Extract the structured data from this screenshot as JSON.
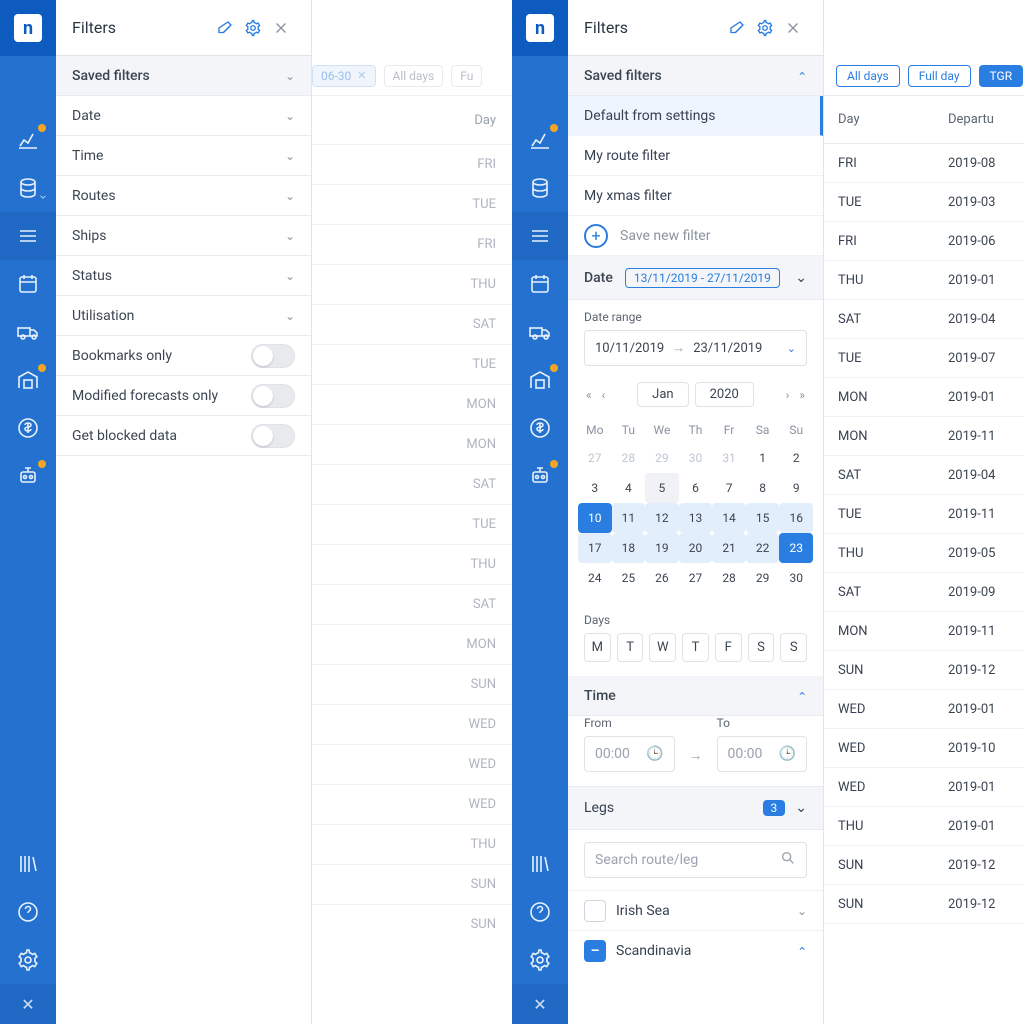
{
  "left": {
    "panelTitle": "Filters",
    "sections": [
      "Saved filters",
      "Date",
      "Time",
      "Routes",
      "Ships",
      "Status",
      "Utilisation"
    ],
    "toggles": [
      "Bookmarks only",
      "Modified forecasts only",
      "Get blocked data"
    ],
    "fadedChipActive": "06-30",
    "fadedChips": [
      "All days",
      "Fu"
    ],
    "dayHeader": "Day",
    "dayRows": [
      "FRI",
      "TUE",
      "FRI",
      "THU",
      "SAT",
      "TUE",
      "MON",
      "MON",
      "SAT",
      "TUE",
      "THU",
      "SAT",
      "MON",
      "SUN",
      "WED",
      "WED",
      "WED",
      "THU",
      "SUN",
      "SUN"
    ],
    "arrowRows": [
      0,
      7,
      14
    ]
  },
  "right": {
    "panelTitle": "Filters",
    "savedHeader": "Saved filters",
    "savedItems": [
      "Default from settings",
      "My route filter",
      "My xmas filter"
    ],
    "saveNew": "Save new filter",
    "dateLabel": "Date",
    "dateChip": "13/11/2019 - 27/11/2019",
    "dateRangeLabel": "Date range",
    "rangeFrom": "10/11/2019",
    "rangeTo": "23/11/2019",
    "monthLabel": "Jan",
    "yearLabel": "2020",
    "weekDays": [
      "Mo",
      "Tu",
      "We",
      "Th",
      "Fr",
      "Sa",
      "Su"
    ],
    "calCells": [
      {
        "n": "27",
        "m": true
      },
      {
        "n": "28",
        "m": true
      },
      {
        "n": "29",
        "m": true
      },
      {
        "n": "30",
        "m": true
      },
      {
        "n": "31",
        "m": true
      },
      {
        "n": "1"
      },
      {
        "n": "2"
      },
      {
        "n": "3"
      },
      {
        "n": "4"
      },
      {
        "n": "5",
        "today": true
      },
      {
        "n": "6"
      },
      {
        "n": "7"
      },
      {
        "n": "8"
      },
      {
        "n": "9"
      },
      {
        "n": "10",
        "start": true
      },
      {
        "n": "11",
        "in": true
      },
      {
        "n": "12",
        "in": true
      },
      {
        "n": "13",
        "in": true
      },
      {
        "n": "14",
        "in": true
      },
      {
        "n": "15",
        "in": true
      },
      {
        "n": "16",
        "in": true
      },
      {
        "n": "17",
        "in": true
      },
      {
        "n": "18",
        "in": true
      },
      {
        "n": "19",
        "in": true
      },
      {
        "n": "20",
        "in": true
      },
      {
        "n": "21",
        "in": true
      },
      {
        "n": "22",
        "in": true
      },
      {
        "n": "23",
        "end": true
      },
      {
        "n": "24"
      },
      {
        "n": "25"
      },
      {
        "n": "26"
      },
      {
        "n": "27"
      },
      {
        "n": "28"
      },
      {
        "n": "29"
      },
      {
        "n": "30"
      }
    ],
    "daysLabel": "Days",
    "dayBtns": [
      "M",
      "T",
      "W",
      "T",
      "F",
      "S",
      "S"
    ],
    "timeLabel": "Time",
    "fromLabel": "From",
    "toLabel": "To",
    "timePh": "00:00",
    "legsLabel": "Legs",
    "legsBadge": "3",
    "searchPh": "Search route/leg",
    "legItems": [
      {
        "name": "Irish Sea",
        "mixed": false,
        "open": false
      },
      {
        "name": "Scandinavia",
        "mixed": true,
        "open": true
      }
    ],
    "chips": [
      "All days",
      "Full day",
      "TGR"
    ],
    "tblDay": "Day",
    "tblDep": "Departu",
    "rows": [
      {
        "d": "FRI",
        "v": "2019-08"
      },
      {
        "d": "TUE",
        "v": "2019-03"
      },
      {
        "d": "FRI",
        "v": "2019-06"
      },
      {
        "d": "THU",
        "v": "2019-01"
      },
      {
        "d": "SAT",
        "v": "2019-04"
      },
      {
        "d": "TUE",
        "v": "2019-07"
      },
      {
        "d": "MON",
        "v": "2019-01"
      },
      {
        "d": "MON",
        "v": "2019-11"
      },
      {
        "d": "SAT",
        "v": "2019-04"
      },
      {
        "d": "TUE",
        "v": "2019-11"
      },
      {
        "d": "THU",
        "v": "2019-05"
      },
      {
        "d": "SAT",
        "v": "2019-09"
      },
      {
        "d": "MON",
        "v": "2019-11"
      },
      {
        "d": "SUN",
        "v": "2019-12"
      },
      {
        "d": "WED",
        "v": "2019-01"
      },
      {
        "d": "WED",
        "v": "2019-10"
      },
      {
        "d": "WED",
        "v": "2019-01"
      },
      {
        "d": "THU",
        "v": "2019-01"
      },
      {
        "d": "SUN",
        "v": "2019-12"
      },
      {
        "d": "SUN",
        "v": "2019-12"
      }
    ]
  }
}
